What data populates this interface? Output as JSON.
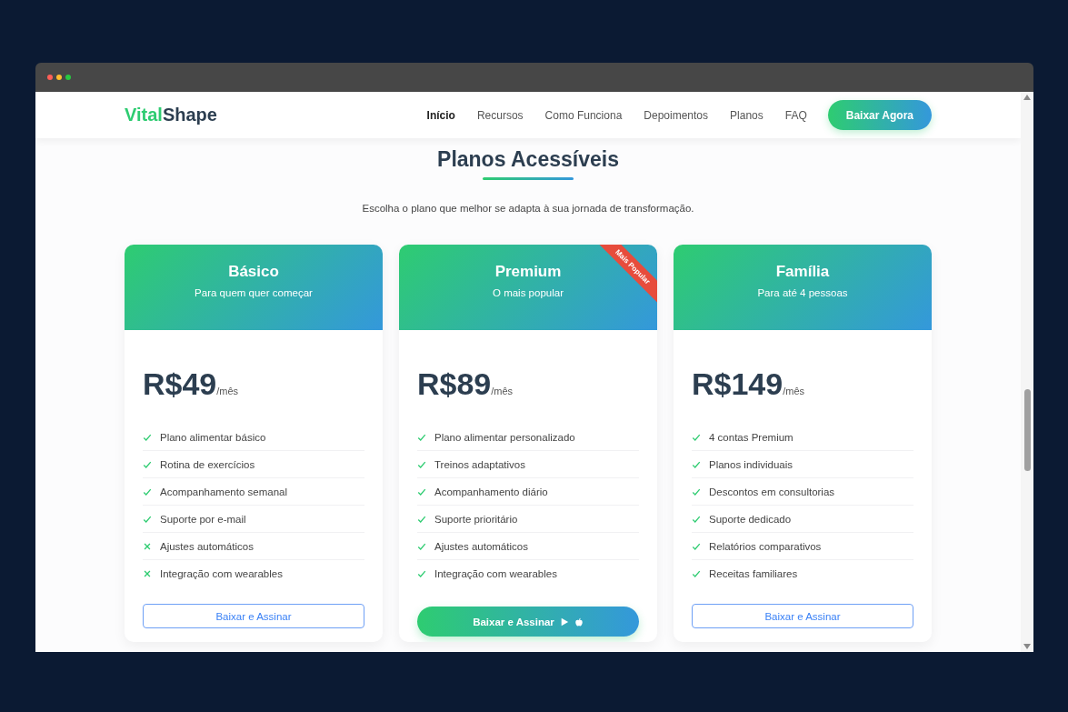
{
  "brand": {
    "part_1": "Vital",
    "part_2": "Shape"
  },
  "nav": [
    {
      "label": "Início",
      "selected": true
    },
    {
      "label": "Recursos",
      "selected": false
    },
    {
      "label": "Como Funciona",
      "selected": false
    },
    {
      "label": "Depoimentos",
      "selected": false
    },
    {
      "label": "Planos",
      "selected": false
    },
    {
      "label": "FAQ",
      "selected": false
    }
  ],
  "cta": "Baixar Agora",
  "section": {
    "title": "Planos Acessíveis",
    "subtitle": "Escolha o plano que melhor se adapta à sua jornada de transformação."
  },
  "plans": [
    {
      "name": "Básico",
      "tagline": "Para quem quer começar",
      "price": "R$49",
      "period": "/mês",
      "featured": false,
      "button": "Baixar e Assinar",
      "features": [
        {
          "text": "Plano alimentar básico",
          "included": true
        },
        {
          "text": "Rotina de exercícios",
          "included": true
        },
        {
          "text": "Acompanhamento semanal",
          "included": true
        },
        {
          "text": "Suporte por e-mail",
          "included": true
        },
        {
          "text": "Ajustes automáticos",
          "included": false
        },
        {
          "text": "Integração com wearables",
          "included": false
        }
      ]
    },
    {
      "name": "Premium",
      "tagline": "O mais popular",
      "price": "R$89",
      "period": "/mês",
      "featured": true,
      "ribbon": "Mais Popular",
      "button": "Baixar e Assinar",
      "features": [
        {
          "text": "Plano alimentar personalizado",
          "included": true
        },
        {
          "text": "Treinos adaptativos",
          "included": true
        },
        {
          "text": "Acompanhamento diário",
          "included": true
        },
        {
          "text": "Suporte prioritário",
          "included": true
        },
        {
          "text": "Ajustes automáticos",
          "included": true
        },
        {
          "text": "Integração com wearables",
          "included": true
        }
      ]
    },
    {
      "name": "Família",
      "tagline": "Para até 4 pessoas",
      "price": "R$149",
      "period": "/mês",
      "featured": false,
      "button": "Baixar e Assinar",
      "features": [
        {
          "text": "4 contas Premium",
          "included": true
        },
        {
          "text": "Planos individuais",
          "included": true
        },
        {
          "text": "Descontos em consultorias",
          "included": true
        },
        {
          "text": "Suporte dedicado",
          "included": true
        },
        {
          "text": "Relatórios comparativos",
          "included": true
        },
        {
          "text": "Receitas familiares",
          "included": true
        }
      ]
    }
  ]
}
